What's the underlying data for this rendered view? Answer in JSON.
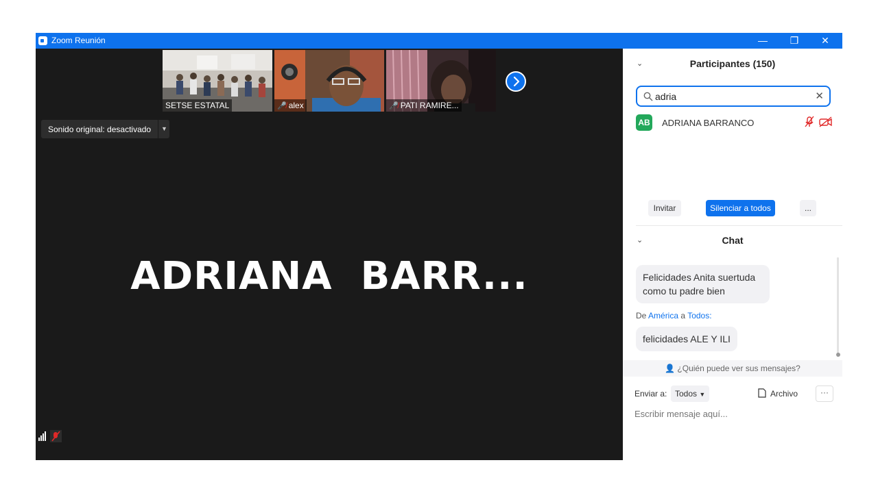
{
  "window": {
    "title": "Zoom Reunión",
    "minimize": "—",
    "restore": "❐",
    "close": "✕"
  },
  "thumbnails": [
    {
      "name": "SETSE ESTATAL",
      "muted": false
    },
    {
      "name": "alex",
      "muted": true
    },
    {
      "name": "PATI RAMIRE...",
      "muted": true
    }
  ],
  "sound": {
    "label": "Sonido original: desactivado"
  },
  "active_speaker": "ADRIANA  BARR...",
  "participants": {
    "header": "Participantes (150)",
    "search_value": "adria",
    "list": [
      {
        "initials": "AB",
        "name": "ADRIANA BARRANCO",
        "avatar_color": "#23a85b",
        "audio_muted": true,
        "video_off": true
      }
    ],
    "buttons": {
      "invite": "Invitar",
      "mute_all": "Silenciar a todos",
      "more": "..."
    }
  },
  "chat": {
    "header": "Chat",
    "messages": [
      {
        "text": "Felicidades Anita suertuda como tu padre bien"
      },
      {
        "prefix": "De",
        "sender": "América",
        "connector": "a",
        "recipient": "Todos:",
        "text": "felicidades ALE Y ILI"
      }
    ],
    "who_can_see": "¿Quién puede ver sus mensajes?",
    "send_to_label": "Enviar a:",
    "send_to_value": "Todos",
    "file_label": "Archivo",
    "more": "···",
    "input_placeholder": "Escribir mensaje aquí..."
  },
  "colors": {
    "accent": "#0e72ed",
    "muted_red": "#e02828",
    "avatar_green": "#23a85b",
    "video_bg": "#1a1a1a"
  }
}
